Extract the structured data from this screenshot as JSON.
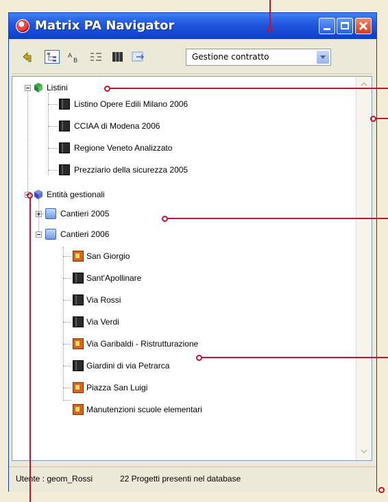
{
  "window": {
    "title": "Matrix PA Navigator"
  },
  "toolbar": {
    "combo_value": "Gestione contratto"
  },
  "tree": {
    "listini": {
      "label": "Listini",
      "items": [
        "Listino Opere Edili Milano 2006",
        "CCIAA di Modena 2006",
        "Regione Veneto Analizzato",
        "Prezziario della sicurezza 2005"
      ]
    },
    "entita": {
      "label": "Entità gestionali",
      "cantieri_2005": "Cantieri 2005",
      "cantieri_2006": {
        "label": "Cantieri 2006",
        "items": [
          "San Giorgio",
          "Sant'Apollinare",
          "Via Rossi",
          "Via Verdi",
          "Via Garibaldi - Ristrutturazione",
          "Giardini di via Petrarca",
          "Piazza San Luigi",
          "Manutenzioni scuole elementari"
        ]
      }
    }
  },
  "status": {
    "user": "Utente : geom_Rossi",
    "projects": "22 Progetti presenti nel database"
  },
  "colors": {
    "callout": "#c8102e",
    "titlebar": "#2358e0",
    "background": "#f3ecd6"
  },
  "icons": {
    "title": "app-icon",
    "minimize": "minimize-icon",
    "maximize": "maximize-icon",
    "close": "close-icon",
    "listino": "book-icon",
    "project": "building-icon",
    "folder": "folder-icon"
  }
}
